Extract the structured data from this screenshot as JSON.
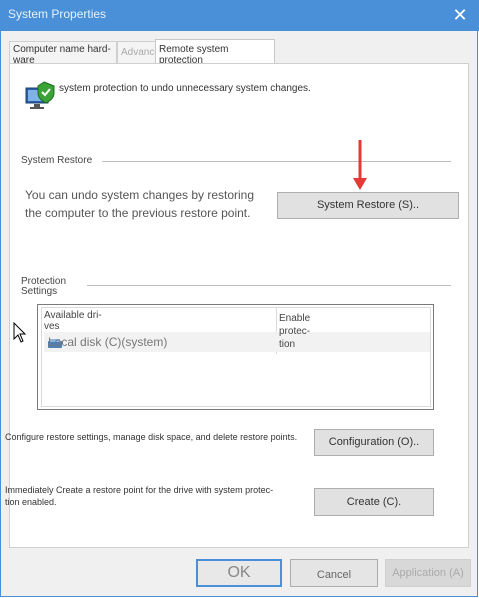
{
  "window": {
    "title": "System Properties",
    "close_symbol": "✕",
    "colors": {
      "titlebar": "#4a90d9",
      "ok_border": "#4a90d9",
      "arrow": "#e53935"
    }
  },
  "tabs": [
    {
      "label": "Computer name hard-ware"
    },
    {
      "label": "Advanced"
    },
    {
      "label": "Remote system protection"
    },
    {
      "label": ""
    }
  ],
  "intro": {
    "text": "system protection to undo unnecessary system changes.",
    "icon": "shield-computer-icon"
  },
  "system_restore": {
    "section_label": "System Restore",
    "description_line1": "You can undo system changes by restoring",
    "description_line2": "the computer to the previous restore point.",
    "button_label": "System Restore (S).."
  },
  "protection": {
    "section_label_line1": "Protection",
    "section_label_line2": "Settings",
    "columns": [
      "Available dri-ves",
      "Enable protec-tion"
    ],
    "drives": [
      {
        "name": "Local disk (C)(system)",
        "icon": "drive-icon"
      }
    ]
  },
  "configure": {
    "description": "Configure restore settings, manage disk space, and delete restore points.",
    "button_label": "Configuration (O).."
  },
  "create": {
    "description_line1": "Immediately Create a restore point for the drive with system protec-",
    "description_line2": "tion enabled.",
    "button_label": "Create (C)."
  },
  "footer": {
    "ok_label": "OK",
    "cancel_label": "Cancel",
    "apply_label": "Application (A)"
  }
}
